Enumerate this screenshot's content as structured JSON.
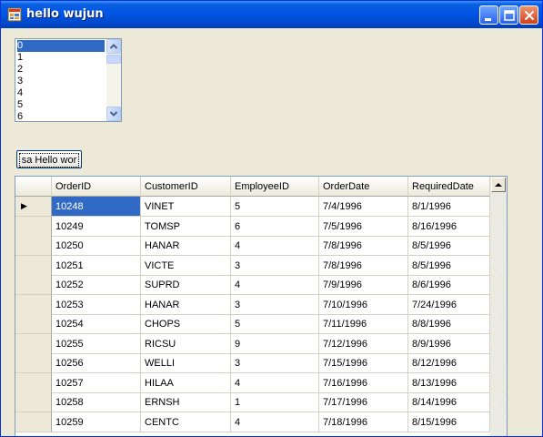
{
  "window": {
    "title": "hello wujun"
  },
  "listbox": {
    "items": [
      "0",
      "1",
      "2",
      "3",
      "4",
      "5",
      "6"
    ],
    "selected": "0"
  },
  "button": {
    "label": "sa Hello wor"
  },
  "grid": {
    "columns": [
      "OrderID",
      "CustomerID",
      "EmployeeID",
      "OrderDate",
      "RequiredDate"
    ],
    "current_row_marker": "▶",
    "rows": [
      [
        "10248",
        "VINET",
        "5",
        "7/4/1996",
        "8/1/1996"
      ],
      [
        "10249",
        "TOMSP",
        "6",
        "7/5/1996",
        "8/16/1996"
      ],
      [
        "10250",
        "HANAR",
        "4",
        "7/8/1996",
        "8/5/1996"
      ],
      [
        "10251",
        "VICTE",
        "3",
        "7/8/1996",
        "8/5/1996"
      ],
      [
        "10252",
        "SUPRD",
        "4",
        "7/9/1996",
        "8/6/1996"
      ],
      [
        "10253",
        "HANAR",
        "3",
        "7/10/1996",
        "7/24/1996"
      ],
      [
        "10254",
        "CHOPS",
        "5",
        "7/11/1996",
        "8/8/1996"
      ],
      [
        "10255",
        "RICSU",
        "9",
        "7/12/1996",
        "8/9/1996"
      ],
      [
        "10256",
        "WELLI",
        "3",
        "7/15/1996",
        "8/12/1996"
      ],
      [
        "10257",
        "HILAA",
        "4",
        "7/16/1996",
        "8/13/1996"
      ],
      [
        "10258",
        "ERNSH",
        "1",
        "7/17/1996",
        "8/14/1996"
      ],
      [
        "10259",
        "CENTC",
        "4",
        "7/18/1996",
        "8/15/1996"
      ]
    ]
  },
  "colors": {
    "title_bar": "#0055e5",
    "selection": "#316ac5",
    "window_bg": "#ece9d8"
  }
}
